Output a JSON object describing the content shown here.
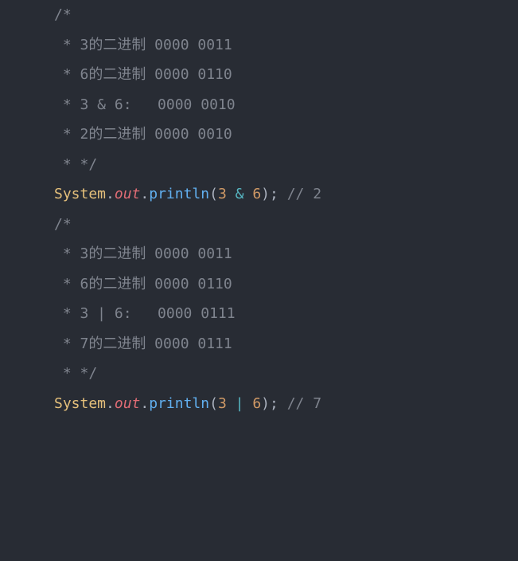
{
  "lines": {
    "l1": "/*",
    "l2": " * 3的二进制 0000 0011",
    "l3": " * 6的二进制 0000 0110",
    "l4": " * 3 & 6:   0000 0010",
    "l5": " * 2的二进制 0000 0010",
    "l6": " * */",
    "l7": "",
    "l8_class": "System",
    "l8_dot1": ".",
    "l8_field": "out",
    "l8_dot2": ".",
    "l8_method": "println",
    "l8_lp": "(",
    "l8_n1": "3",
    "l8_sp1": " ",
    "l8_op": "&",
    "l8_sp2": " ",
    "l8_n2": "6",
    "l8_rp": ")",
    "l8_semi": ";",
    "l8_sp3": " ",
    "l8_cmt": "// 2",
    "l9": "",
    "l10": "/*",
    "l11": " * 3的二进制 0000 0011",
    "l12": " * 6的二进制 0000 0110",
    "l13": " * 3 | 6:   0000 0111",
    "l14": " * 7的二进制 0000 0111",
    "l15": " * */",
    "l16": "",
    "l17_class": "System",
    "l17_dot1": ".",
    "l17_field": "out",
    "l17_dot2": ".",
    "l17_method": "println",
    "l17_lp": "(",
    "l17_n1": "3",
    "l17_sp1": " ",
    "l17_op": "|",
    "l17_sp2": " ",
    "l17_n2": "6",
    "l17_rp": ")",
    "l17_semi": ";",
    "l17_sp3": " ",
    "l17_cmt": "// 7"
  }
}
